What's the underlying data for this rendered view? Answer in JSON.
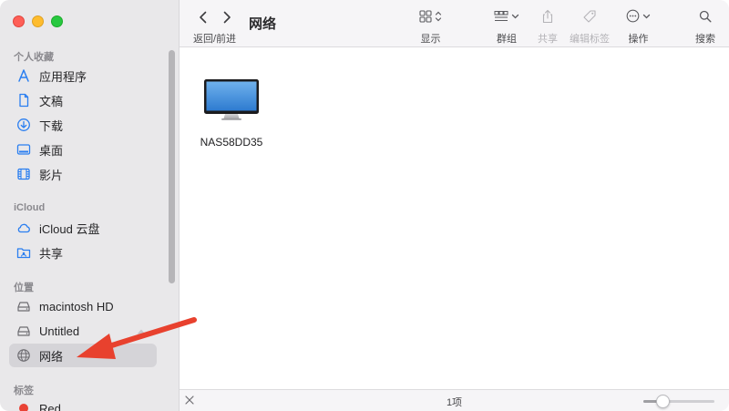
{
  "window": {
    "title": "网络",
    "nav_label": "返回/前进"
  },
  "toolbar": {
    "buttons": [
      {
        "label": "显示",
        "icon": "grid-view-icon"
      },
      {
        "label": "群组",
        "icon": "group-icon"
      },
      {
        "label": "共享",
        "icon": "share-icon",
        "disabled": true
      },
      {
        "label": "编辑标签",
        "icon": "tag-icon",
        "disabled": true
      },
      {
        "label": "操作",
        "icon": "more-icon"
      },
      {
        "label": "搜索",
        "icon": "search-icon"
      }
    ]
  },
  "sidebar": {
    "favorites_title": "个人收藏",
    "favorites": [
      {
        "label": "应用程序",
        "icon": "applications-icon"
      },
      {
        "label": "文稿",
        "icon": "document-icon"
      },
      {
        "label": "下载",
        "icon": "download-icon"
      },
      {
        "label": "桌面",
        "icon": "desktop-icon"
      },
      {
        "label": "影片",
        "icon": "movies-icon"
      }
    ],
    "icloud_title": "iCloud",
    "icloud": [
      {
        "label": "iCloud 云盘",
        "icon": "cloud-icon"
      },
      {
        "label": "共享",
        "icon": "shared-folder-icon"
      }
    ],
    "locations_title": "位置",
    "locations": [
      {
        "label": "macintosh HD",
        "icon": "disk-icon"
      },
      {
        "label": "Untitled",
        "icon": "disk-icon"
      },
      {
        "label": "网络",
        "icon": "network-icon",
        "selected": true
      }
    ],
    "tags_title": "标签",
    "tags": [
      {
        "label": "Red",
        "color": "#e94235"
      }
    ]
  },
  "content": {
    "items": [
      {
        "label": "NAS58DD35",
        "icon": "monitor-icon"
      }
    ]
  },
  "statusbar": {
    "item_count": "1项",
    "zoom_level": 0.27
  },
  "colors": {
    "accent": "#2a7ef0",
    "annotation_arrow": "#e8412e",
    "selected_bg": "#d5d4d8"
  }
}
